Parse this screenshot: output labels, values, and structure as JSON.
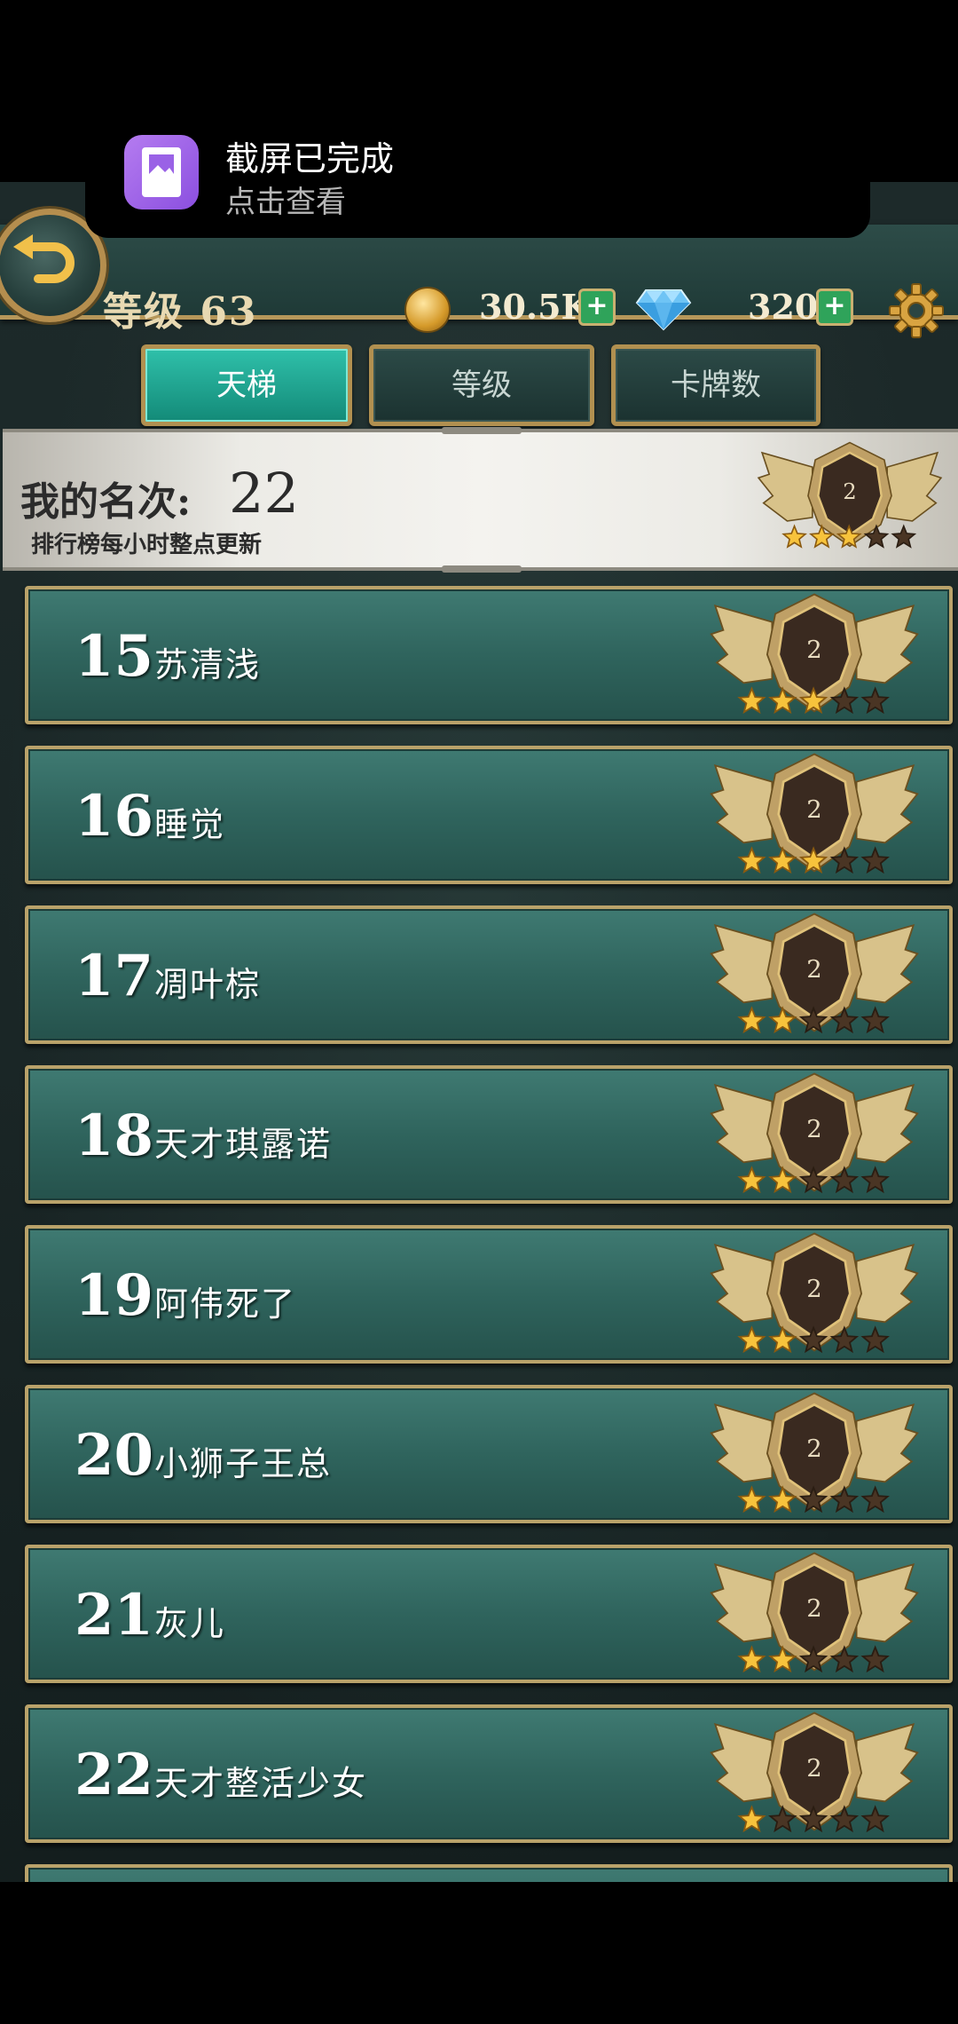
{
  "notification": {
    "title": "截屏已完成",
    "subtitle": "点击查看",
    "icon": "screenshot-icon"
  },
  "header": {
    "level_label": "等级 63",
    "coins": "30.5K",
    "gems": "320",
    "icons": [
      "back-arrow-icon",
      "coin-icon",
      "diamond-icon",
      "gear-icon",
      "plus-icon"
    ]
  },
  "tabs": [
    {
      "label": "天梯",
      "active": true
    },
    {
      "label": "等级",
      "active": false
    },
    {
      "label": "卡牌数",
      "active": false
    }
  ],
  "my_rank": {
    "label": "我的名次:",
    "value": "22",
    "note": "排行榜每小时整点更新",
    "badge": {
      "tier": "2",
      "stars": 3
    }
  },
  "ranking": [
    {
      "rank": "15",
      "name": "苏清浅",
      "tier": "2",
      "stars": 3
    },
    {
      "rank": "16",
      "name": "睡觉",
      "tier": "2",
      "stars": 3
    },
    {
      "rank": "17",
      "name": "凋叶棕",
      "tier": "2",
      "stars": 2
    },
    {
      "rank": "18",
      "name": "天才琪露诺",
      "tier": "2",
      "stars": 2
    },
    {
      "rank": "19",
      "name": "阿伟死了",
      "tier": "2",
      "stars": 2
    },
    {
      "rank": "20",
      "name": "小狮子王总",
      "tier": "2",
      "stars": 2
    },
    {
      "rank": "21",
      "name": "灰儿",
      "tier": "2",
      "stars": 2
    },
    {
      "rank": "22",
      "name": "天才整活少女",
      "tier": "2",
      "stars": 1
    }
  ],
  "colors": {
    "accent_tab": "#1ea893",
    "gold_border": "#b9a26a",
    "row_bg": "#2f645d",
    "plus_green": "#2fa35a"
  }
}
